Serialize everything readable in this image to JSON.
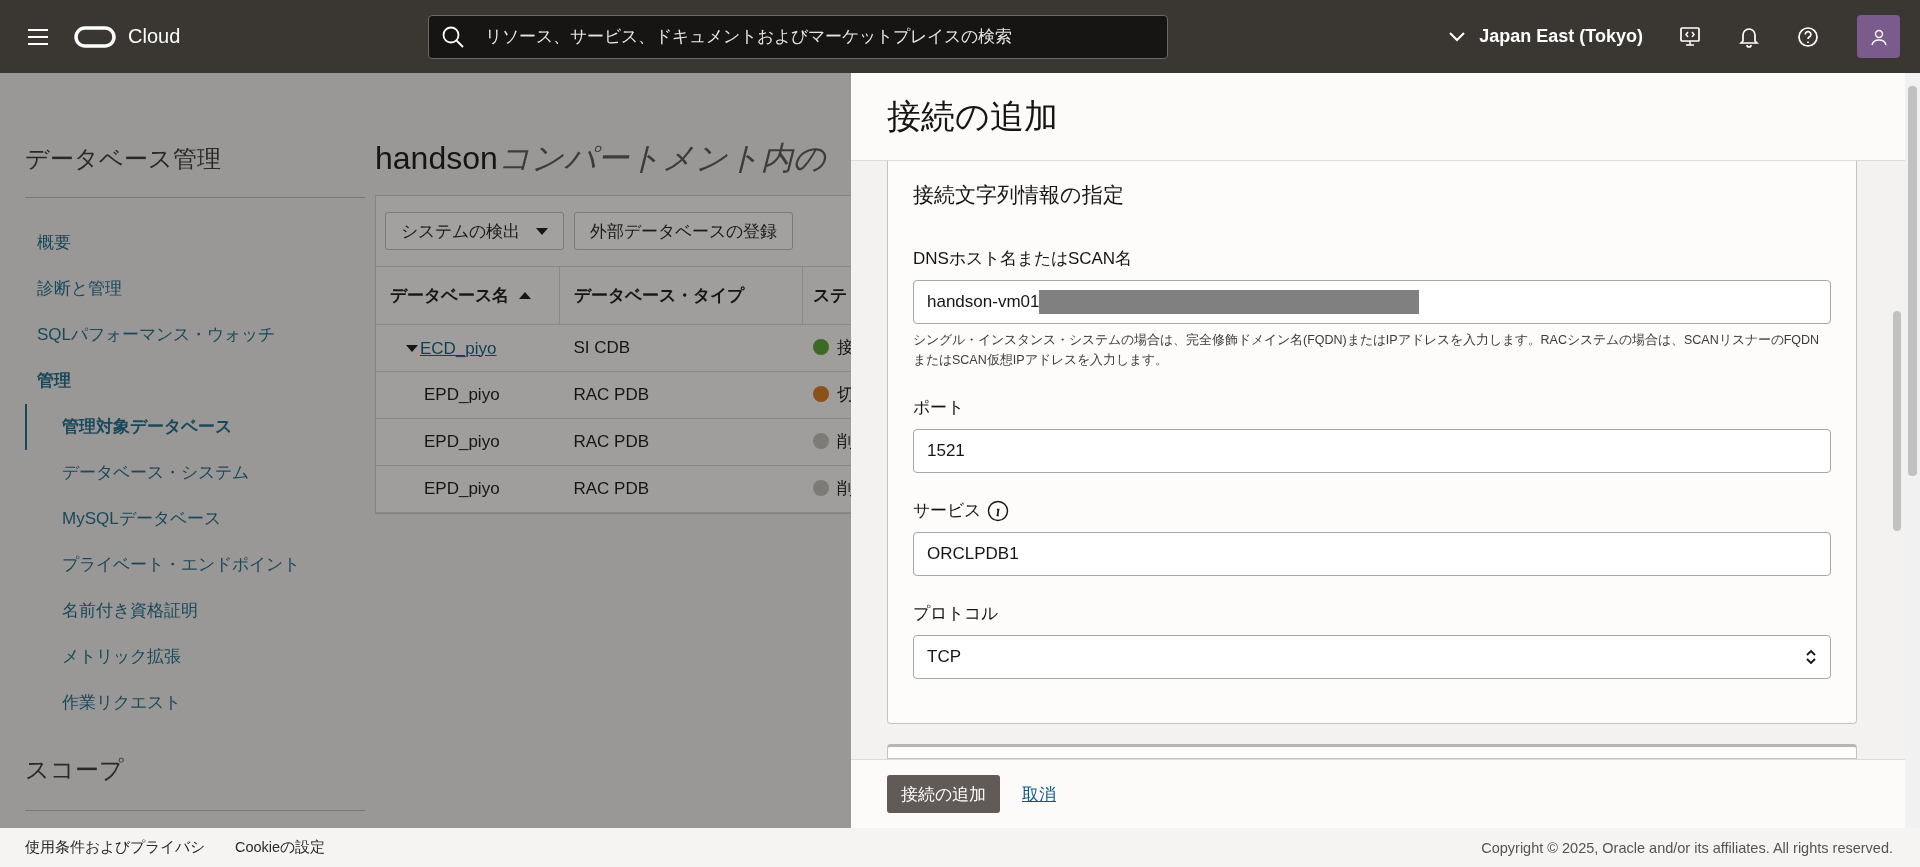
{
  "header": {
    "brand": "Cloud",
    "search": {
      "placeholder": "リソース、サービス、ドキュメントおよびマーケットプレイスの検索"
    },
    "region": "Japan East (Tokyo)"
  },
  "sidebar": {
    "title": "データベース管理",
    "items": [
      {
        "label": "概要",
        "kind": "link",
        "selected": false
      },
      {
        "label": "診断と管理",
        "kind": "link",
        "selected": false
      },
      {
        "label": "SQLパフォーマンス・ウォッチ",
        "kind": "link",
        "selected": false
      },
      {
        "label": "管理",
        "kind": "group",
        "selected": false,
        "children": [
          {
            "label": "管理対象データベース",
            "kind": "link",
            "selected": true
          },
          {
            "label": "データベース・システム",
            "kind": "link",
            "selected": false
          },
          {
            "label": "MySQLデータベース",
            "kind": "link",
            "selected": false
          },
          {
            "label": "プライベート・エンドポイント",
            "kind": "link",
            "selected": false
          },
          {
            "label": "名前付き資格証明",
            "kind": "link",
            "selected": false
          },
          {
            "label": "メトリック拡張",
            "kind": "link",
            "selected": false
          },
          {
            "label": "作業リクエスト",
            "kind": "link",
            "selected": false
          }
        ]
      }
    ],
    "scope_title": "スコープ"
  },
  "main": {
    "title_name": "handson",
    "title_rest": "コンパートメント内の",
    "toolbar": [
      {
        "label": "システムの検出",
        "kind": "dropdown"
      },
      {
        "label": "外部データベースの登録",
        "kind": "button"
      }
    ],
    "table": {
      "columns": [
        {
          "label": "データベース名",
          "sorted": true
        },
        {
          "label": "データベース・タイプ"
        },
        {
          "label": "ステ"
        }
      ],
      "rows": [
        {
          "name": "ECD_piyo",
          "type": "SI CDB",
          "status": "接",
          "color": "#3c6a24",
          "expanded": true,
          "children": [
            {
              "name": "EPD_piyo",
              "type": "RAC PDB",
              "status": "切",
              "color": "#8a5218"
            },
            {
              "name": "EPD_piyo",
              "type": "RAC PDB",
              "status": "削",
              "color": "#7d7b78"
            },
            {
              "name": "EPD_piyo",
              "type": "RAC PDB",
              "status": "削",
              "color": "#7d7b78"
            }
          ]
        }
      ]
    }
  },
  "drawer": {
    "title": "接続の追加",
    "section_title": "接続文字列情報の指定",
    "fields": [
      {
        "label": "DNSホスト名またはSCAN名",
        "kind": "text",
        "value": "handson-vm01",
        "redacted": true,
        "help": "シングル・インスタンス・システムの場合は、完全修飾ドメイン名(FQDN)またはIPアドレスを入力します。RACシステムの場合は、SCANリスナーのFQDNまたはSCAN仮想IPアドレスを入力します。"
      },
      {
        "label": "ポート",
        "kind": "text",
        "value": "1521"
      },
      {
        "label": "サービス",
        "kind": "text",
        "value": "ORCLPDB1",
        "info": true
      },
      {
        "label": "プロトコル",
        "kind": "select",
        "value": "TCP"
      }
    ],
    "primary_button": "接続の追加",
    "cancel_link": "取消"
  },
  "footer": {
    "links": [
      "使用条件およびプライバシ",
      "Cookieの設定"
    ],
    "copyright": "Copyright © 2025, Oracle and/or its affiliates. All rights reserved."
  }
}
